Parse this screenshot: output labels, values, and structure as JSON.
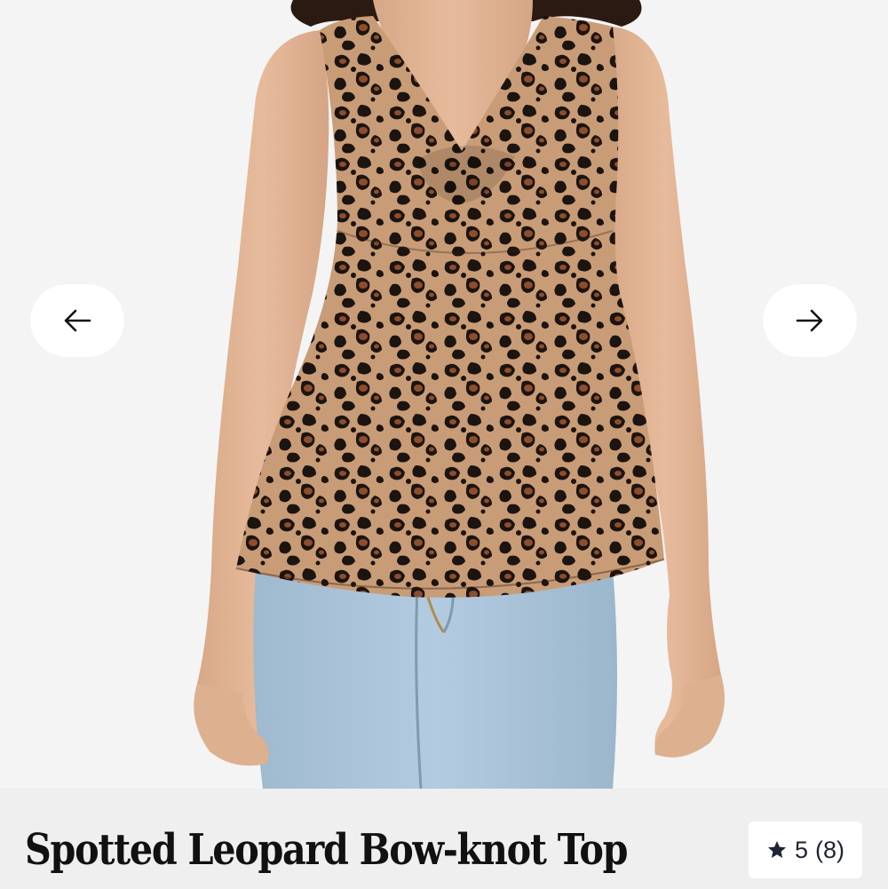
{
  "product": {
    "title": "Spotted Leopard Bow-knot Top",
    "rating": {
      "score": "5",
      "count": "(8)",
      "icon": "star-icon"
    }
  },
  "gallery": {
    "prev_icon": "arrow-left-icon",
    "next_icon": "arrow-right-icon"
  },
  "colors": {
    "background": "#f4f4f4",
    "info_bar": "#efefef",
    "badge_bg": "#ffffff",
    "text": "#111111",
    "leopard_base": "#c79a73",
    "leopard_spot": "#1b1410",
    "leopard_inner": "#8a4a2a",
    "denim": "#a7c2d8",
    "skin": "#e3b79a"
  }
}
